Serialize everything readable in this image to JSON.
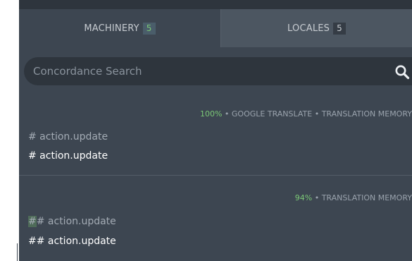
{
  "tabs": {
    "machinery_label": "MACHINERY",
    "machinery_count": "5",
    "locales_label": "LOCALES",
    "locales_count": "5"
  },
  "search": {
    "placeholder": "Concordance Search",
    "icon": "search-icon"
  },
  "entries": [
    {
      "quality": "100%",
      "separator": " • ",
      "sources": "GOOGLE TRANSLATE • TRANSLATION MEMORY",
      "original": "# action.update",
      "translation": "# action.update"
    },
    {
      "quality": "94%",
      "separator": " • ",
      "sources": "TRANSLATION MEMORY",
      "original_highlight": "#",
      "original_rest": "# action.update",
      "translation": "## action.update"
    }
  ],
  "colors": {
    "panel": "#3d4651",
    "active_tab": "#3d4651",
    "inactive_tab": "#4c5661",
    "search_bg": "#2e353d",
    "quality_green": "#7bc876",
    "highlight": "#4e6b58"
  }
}
